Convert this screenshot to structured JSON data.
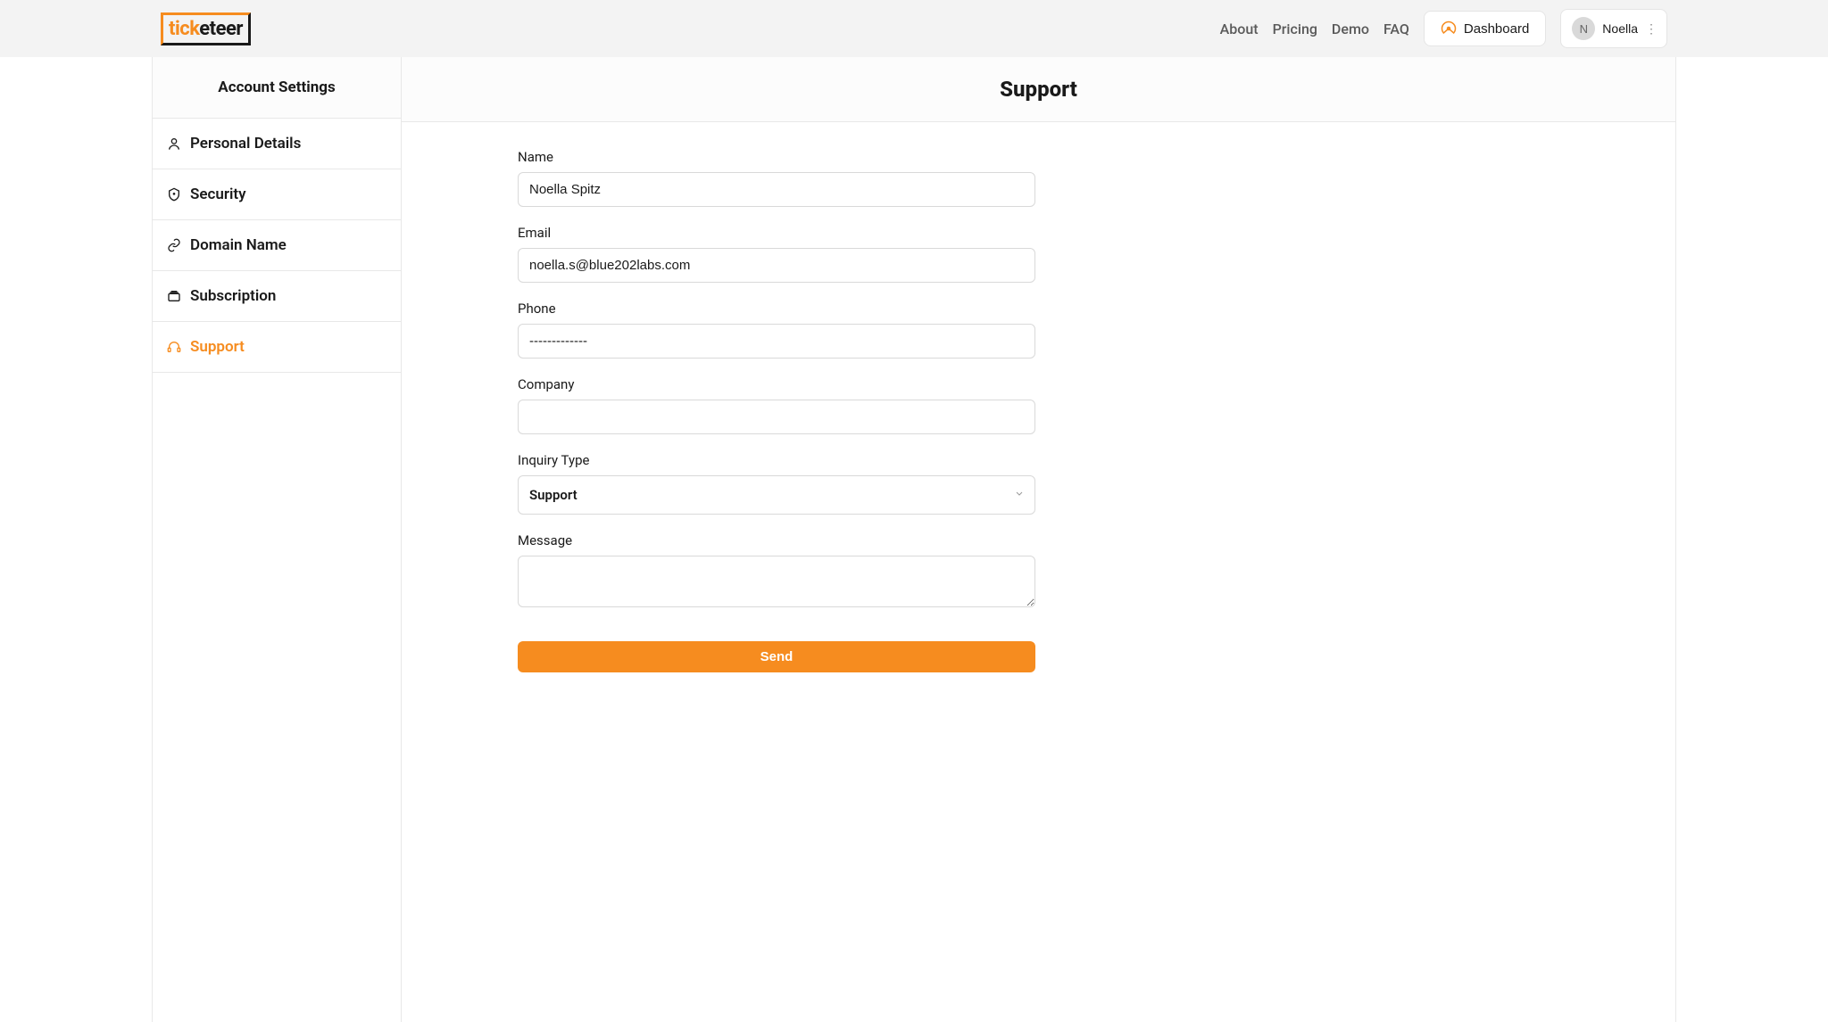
{
  "header": {
    "logo_tick": "tick",
    "logo_eteer": "eteer",
    "nav": {
      "about": "About",
      "pricing": "Pricing",
      "demo": "Demo",
      "faq": "FAQ"
    },
    "dashboard_label": "Dashboard",
    "user": {
      "initial": "N",
      "name": "Noella"
    }
  },
  "sidebar": {
    "title": "Account Settings",
    "items": [
      {
        "label": "Personal Details"
      },
      {
        "label": "Security"
      },
      {
        "label": "Domain Name"
      },
      {
        "label": "Subscription"
      },
      {
        "label": "Support"
      }
    ]
  },
  "main": {
    "title": "Support",
    "form": {
      "name_label": "Name",
      "name_value": "Noella Spitz",
      "email_label": "Email",
      "email_value": "noella.s@blue202labs.com",
      "phone_label": "Phone",
      "phone_value": "-------------",
      "company_label": "Company",
      "company_value": "",
      "inquiry_label": "Inquiry Type",
      "inquiry_value": "Support",
      "message_label": "Message",
      "message_value": "",
      "send_label": "Send"
    }
  }
}
